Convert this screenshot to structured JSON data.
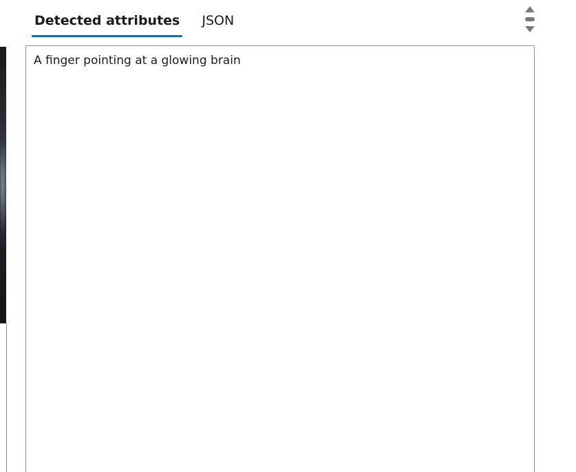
{
  "tabs": [
    {
      "label": "Detected attributes",
      "active": true
    },
    {
      "label": "JSON",
      "active": false
    }
  ],
  "content": {
    "caption": "A finger pointing at a glowing brain"
  },
  "icons": {
    "scroll_up": "triangle-up-icon",
    "scroll_thumb": "scroll-thumb",
    "scroll_down": "triangle-down-icon"
  },
  "colors": {
    "accent": "#0f6cbd",
    "border": "#8a8a8a",
    "text": "#1b1b1b",
    "scroll": "#7a7a7a"
  }
}
